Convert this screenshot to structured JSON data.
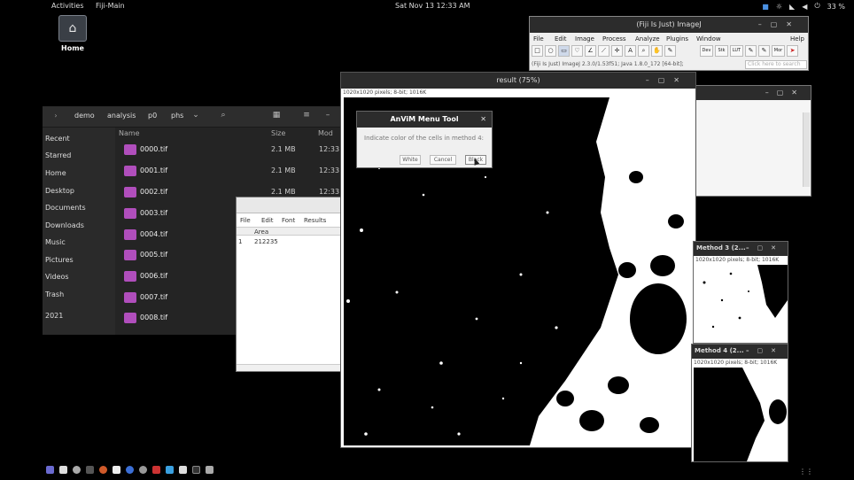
{
  "topbar": {
    "activities": "Activities",
    "app": "Fiji-Main",
    "clock": "Sat Nov 13  12:33 AM",
    "battery": "33 %"
  },
  "desktop": {
    "home_label": "Home"
  },
  "files": {
    "breadcrumbs": [
      "demo",
      "analysis",
      "p0",
      "phs"
    ],
    "sidebar": [
      "Recent",
      "Starred",
      "Home",
      "Desktop",
      "Documents",
      "Downloads",
      "Music",
      "Pictures",
      "Videos",
      "Trash",
      "2021"
    ],
    "columns": {
      "name": "Name",
      "size": "Size",
      "modified": "Mod"
    },
    "rows": [
      {
        "name": "0000.tif",
        "size": "2.1 MB",
        "mod": "12:33"
      },
      {
        "name": "0001.tif",
        "size": "2.1 MB",
        "mod": "12:33"
      },
      {
        "name": "0002.tif",
        "size": "2.1 MB",
        "mod": "12:33"
      },
      {
        "name": "0003.tif",
        "size": "",
        "mod": ""
      },
      {
        "name": "0004.tif",
        "size": "",
        "mod": ""
      },
      {
        "name": "0005.tif",
        "size": "",
        "mod": ""
      },
      {
        "name": "0006.tif",
        "size": "",
        "mod": ""
      },
      {
        "name": "0007.tif",
        "size": "",
        "mod": ""
      },
      {
        "name": "0008.tif",
        "size": "",
        "mod": ""
      }
    ]
  },
  "results": {
    "menu": [
      "File",
      "Edit",
      "Font",
      "Results"
    ],
    "header": "Area",
    "index": "1",
    "value": "212235"
  },
  "imagej": {
    "title": "(Fiji Is Just) ImageJ",
    "menu": [
      "File",
      "Edit",
      "Image",
      "Process",
      "Analyze",
      "Plugins",
      "Window",
      "Help"
    ],
    "tools": [
      "□",
      "○",
      "▭",
      "♡",
      "∠",
      "⟋",
      "✛",
      "A",
      "⌕",
      "✋",
      "✎",
      "Dev",
      "Stk",
      "LUT",
      "✎",
      "✎",
      "Mor",
      "➤"
    ],
    "status": "(Fiji Is Just) ImageJ 2.3.0/1.53f51; Java 1.8.0_172 [64-bit];",
    "search_placeholder": "Click here to search"
  },
  "result_window": {
    "title": "result (75%)",
    "info": "1020x1020 pixels; 8-bit; 1016K"
  },
  "dialog": {
    "title": "AnViM Menu Tool",
    "message": "Indicate color of the cells in method 4:",
    "buttons": [
      "White",
      "Cancel",
      "Black"
    ]
  },
  "method3": {
    "title": "Method 3 (2...",
    "info": "1020x1020 pixels; 8-bit; 1016K"
  },
  "method4": {
    "title": "Method 4 (2...",
    "info": "1020x1020 pixels; 8-bit; 1016K"
  }
}
